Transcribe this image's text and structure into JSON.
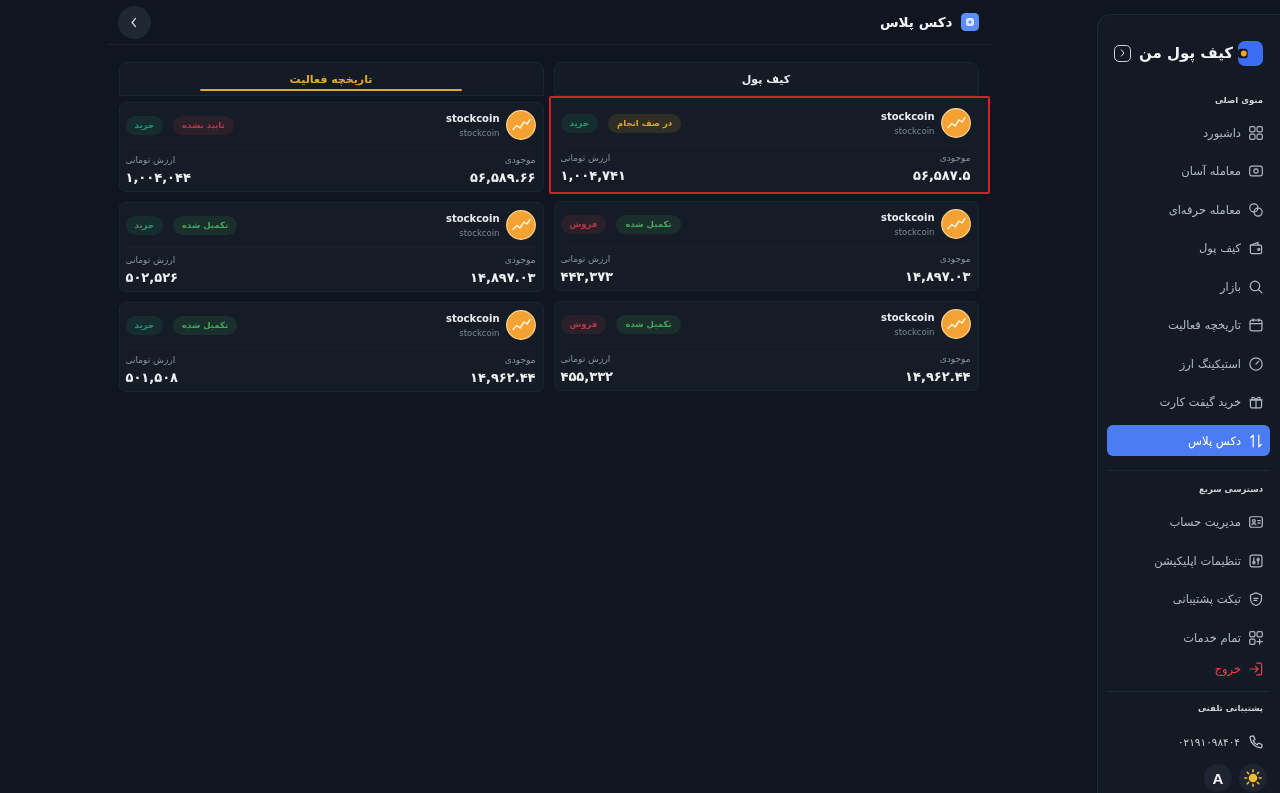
{
  "sidebar": {
    "logo": {
      "text": "کیف پول من"
    },
    "sections": [
      {
        "title": "منوی اصلی",
        "items": [
          {
            "label": "داشبورد",
            "selected": false
          },
          {
            "label": "معامله آسان",
            "selected": false
          },
          {
            "label": "معامله حرفه‌ای",
            "selected": false
          },
          {
            "label": "کیف پول",
            "selected": false
          },
          {
            "label": "بازار",
            "selected": false
          },
          {
            "label": "تاریخچه فعالیت",
            "selected": false
          },
          {
            "label": "استیکینگ ارز",
            "selected": false
          },
          {
            "label": "خرید گیفت کارت",
            "selected": false
          },
          {
            "label": "دکس پلاس",
            "selected": true
          }
        ]
      },
      {
        "title": "دسترسی سریع",
        "items": [
          {
            "label": "مدیریت حساب",
            "kind": "link",
            "selected": false
          },
          {
            "label": "تنظیمات اپلیکیشن",
            "kind": "link",
            "selected": false
          },
          {
            "label": "تیکت پشتیبانی",
            "kind": "link",
            "selected": false
          },
          {
            "label": "تمام خدمات",
            "kind": "link",
            "selected": false
          },
          {
            "label": "خروج",
            "kind": "logout",
            "selected": false
          }
        ]
      }
    ],
    "support": {
      "title": "پشتیبانی تلفنی",
      "phone": "۰۲۱۹۱۰۹۸۴۰۴"
    },
    "font_button": {
      "label": "A"
    }
  },
  "header": {
    "title": "دکس پلاس"
  },
  "panels": [
    {
      "tab": {
        "label": "کیف پول",
        "selected": false
      },
      "cards": [
        {
          "name": "stockcoin",
          "symbol": "stockcoin",
          "status": {
            "label": "در صف انجام",
            "color": "#d9a62b"
          },
          "side": {
            "label": "خرید",
            "color": "#1f9a70"
          },
          "balance_label": "موجودی",
          "balance": "۵۶,۵۸۷.۵",
          "value_label": "ارزش تومانی",
          "value": "۱,۰۰۴,۷۴۱",
          "highlighted": true
        },
        {
          "name": "stockcoin",
          "symbol": "stockcoin",
          "status": {
            "label": "تکمیل شده",
            "color": "#3fa85c"
          },
          "side": {
            "label": "فروش",
            "color": "#b23a48"
          },
          "balance_label": "موجودی",
          "balance": "۱۴,۸۹۷.۰۳",
          "value_label": "ارزش تومانی",
          "value": "۴۴۳,۳۷۳",
          "highlighted": false
        },
        {
          "name": "stockcoin",
          "symbol": "stockcoin",
          "status": {
            "label": "تکمیل شده",
            "color": "#3fa85c"
          },
          "side": {
            "label": "فروش",
            "color": "#b23a48"
          },
          "balance_label": "موجودی",
          "balance": "۱۴,۹۶۲.۴۴",
          "value_label": "ارزش تومانی",
          "value": "۴۵۵,۳۳۲",
          "highlighted": false
        }
      ]
    },
    {
      "tab": {
        "label": "تاریخچه فعالیت",
        "selected": true
      },
      "cards": [
        {
          "name": "stockcoin",
          "symbol": "stockcoin",
          "status": {
            "label": "تایید نشده",
            "color": "#b8394a"
          },
          "side": {
            "label": "خرید",
            "color": "#1f9a70"
          },
          "balance_label": "موجودی",
          "balance": "۵۶,۵۸۹.۶۶",
          "value_label": "ارزش تومانی",
          "value": "۱,۰۰۴,۰۴۴",
          "highlighted": false
        },
        {
          "name": "stockcoin",
          "symbol": "stockcoin",
          "status": {
            "label": "تکمیل شده",
            "color": "#3fa85c"
          },
          "side": {
            "label": "خرید",
            "color": "#1f9a70"
          },
          "balance_label": "موجودی",
          "balance": "۱۴,۸۹۷.۰۳",
          "value_label": "ارزش تومانی",
          "value": "۵۰۲,۵۲۶",
          "highlighted": false
        },
        {
          "name": "stockcoin",
          "symbol": "stockcoin",
          "status": {
            "label": "تکمیل شده",
            "color": "#3fa85c"
          },
          "side": {
            "label": "خرید",
            "color": "#1f9a70"
          },
          "balance_label": "موجودی",
          "balance": "۱۴,۹۶۲.۴۴",
          "value_label": "ارزش تومانی",
          "value": "۵۰۱,۵۰۸",
          "highlighted": false
        }
      ]
    }
  ]
}
